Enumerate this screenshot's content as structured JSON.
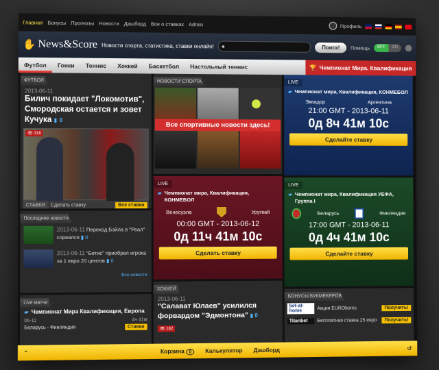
{
  "topnav": {
    "items": [
      "Главная",
      "Бонусы",
      "Прогнозы",
      "Новости",
      "Дашборд",
      "Все о ставках",
      "Admin"
    ],
    "profile": "Профиль"
  },
  "header": {
    "logo": "News&Score",
    "tagline": "Новости спорта, статистика, ставки онлайн!",
    "search_button": "Поиск!",
    "help": "Помощь",
    "toggle_on": "OFF",
    "toggle_off": "ON"
  },
  "sportmenu": {
    "items": [
      "Футбол",
      "Гонки",
      "Теннис",
      "Хоккей",
      "Баскетбол",
      "Настольный теннис"
    ],
    "championship": "Чемпионат Мира. Квалификация"
  },
  "football": {
    "section": "ФУТБОЛ",
    "date": "2013-06-11",
    "title": "Билич покидает \"Локомотив\", Смородская остается и зовет Кучука",
    "comments": "0",
    "views": "316",
    "bets_label": "СТАВКИ",
    "make_bet": "Сделать ставку",
    "all_bets": "Все ставки"
  },
  "latest": {
    "section": "Последние новости",
    "items": [
      {
        "date": "2013-06-11",
        "text": "Переход Бэйла в \"Реал\" сорвался",
        "comments": "0"
      },
      {
        "date": "2013-06-11",
        "text": "\"Бетис\" приобрел игрока за 1 евро 20 центов",
        "comments": "0"
      }
    ],
    "all_news": "Все новости"
  },
  "live_matches": {
    "section": "Live матчи",
    "title": "Чемпионат Мира Квалификация, Европа",
    "date": "06-11",
    "time": "4ч 41м",
    "teams": "Беларусь - Финляндия",
    "bet": "Ставки"
  },
  "sports_news": {
    "section": "НОВОСТИ СПОРТА",
    "banner": "Все спортивные новости здесь!"
  },
  "match1": {
    "live": "LIVE",
    "title": "Чемпионат мира, Квалификация, КОНМЕБОЛ",
    "home": "Эквадор",
    "away": "Аргентина",
    "time": "21:00 GMT",
    "date": "2013-06-11",
    "countdown": "0д 8ч 41м 10с",
    "button": "Сделайте ставку"
  },
  "match2": {
    "live": "LIVE",
    "title": "Чемпионат мира, Квалификация, КОНМЕБОЛ",
    "home": "Венесуэла",
    "away": "Уругвай",
    "time": "00:00 GMT",
    "date": "2013-06-12",
    "countdown": "0д 11ч 41м 10с",
    "button": "Сделать ставку"
  },
  "match3": {
    "live": "LIVE",
    "title": "Чемпионат мира, Квалификация УЕФА, Группа I",
    "home": "Беларусь",
    "away": "Финляндия",
    "time": "17:00 GMT",
    "date": "2013-06-11",
    "countdown": "0д 4ч 41м 10с",
    "button": "Сделайте ставку"
  },
  "hockey": {
    "section": "ХОККЕЙ",
    "date": "2013-06-11",
    "title": "\"Салават Юлаев\" усилился форвардом \"Эдмонтона\"",
    "comments": "0",
    "views": "182"
  },
  "bonuses": {
    "section": "БОНУСЫ БУКМЕКЕРОВ",
    "items": [
      {
        "logo": "bet-at-home",
        "text": "Акция EUROboms",
        "button": "Получить!"
      },
      {
        "logo": "Titanbet",
        "text": "Бесплатная ставка 25 евро",
        "button": "Получить!"
      }
    ]
  },
  "bottombar": {
    "cart": "Корзина",
    "cart_count": "0",
    "calculator": "Калькулятор",
    "dashboard": "Дашборд"
  }
}
